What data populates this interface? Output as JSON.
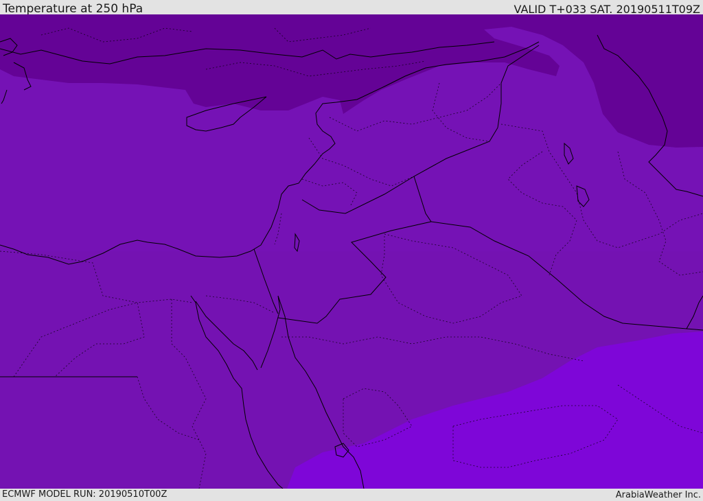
{
  "header": {
    "title": "Temperature at 250 hPa",
    "valid": "VALID T+033 SAT. 20190511T09Z"
  },
  "footer": {
    "model_run": "ECMWF MODEL RUN: 20190510T00Z",
    "credit": "ArabiaWeather Inc."
  },
  "map": {
    "colors": {
      "base": "#7512b5",
      "north_cold": "#640396",
      "south_warm": "#7e06d8",
      "boundary": "#000000"
    }
  }
}
